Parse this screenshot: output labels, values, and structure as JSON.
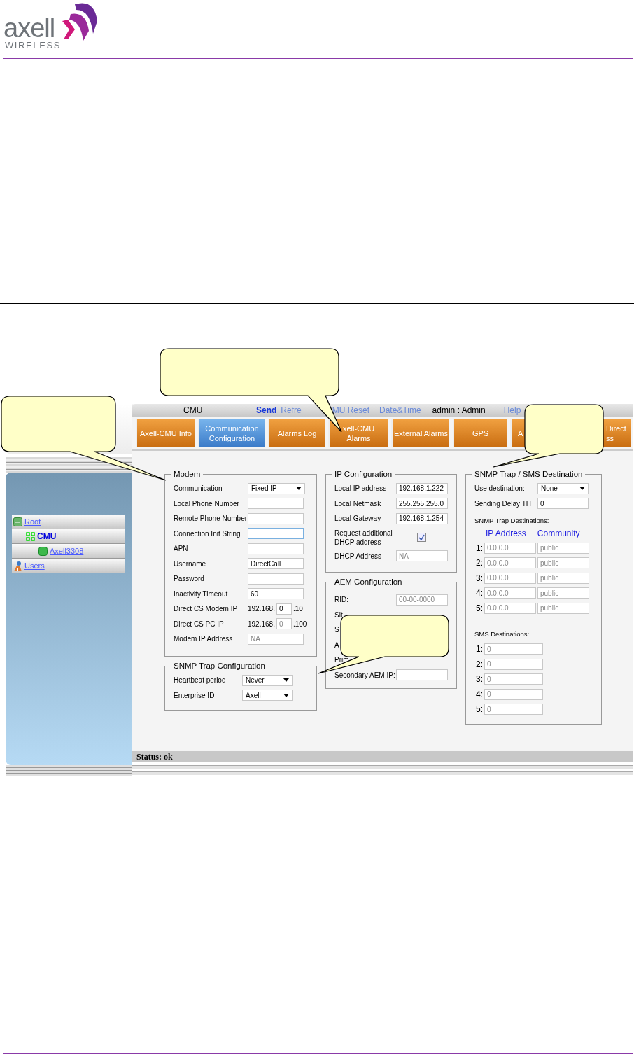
{
  "header": {
    "logo_word": "axell",
    "logo_sub": "WIRELESS"
  },
  "app": {
    "sidebar": {
      "tree": [
        {
          "label": "Root",
          "kind": "root",
          "selected": false,
          "children": [
            {
              "label": "CMU",
              "kind": "group",
              "selected": true,
              "children": [
                {
                  "label": "Axell3308",
                  "kind": "device",
                  "selected": false
                }
              ]
            }
          ]
        },
        {
          "label": "Users",
          "kind": "users",
          "selected": false
        }
      ]
    },
    "topbar": {
      "title": "CMU",
      "items": [
        {
          "label": "Send",
          "kind": "primary-link"
        },
        {
          "label": "Refre",
          "kind": "link"
        },
        {
          "label": "MU Reset",
          "kind": "link"
        },
        {
          "label": "Date&Time",
          "kind": "link"
        },
        {
          "label": "admin : Admin",
          "kind": "user"
        },
        {
          "label": "Help",
          "kind": "link"
        }
      ]
    },
    "tabs": [
      {
        "label": "Axell-CMU Info",
        "selected": false
      },
      {
        "label": "Communication\nConfiguration",
        "selected": true
      },
      {
        "label": "Alarms Log",
        "selected": false
      },
      {
        "label": "xell-CMU\nAlarms",
        "selected": false
      },
      {
        "label": "External Alarms",
        "selected": false
      },
      {
        "label": "GPS",
        "selected": false
      },
      {
        "label": "A",
        "selected": false
      },
      {
        "label": "Direct\nss",
        "selected": false
      }
    ],
    "modem": {
      "title": "Modem",
      "fields": [
        {
          "label": "Communication",
          "kind": "select",
          "value": "Fixed IP"
        },
        {
          "label": "Local Phone Number",
          "kind": "input"
        },
        {
          "label": "Remote Phone Number",
          "kind": "input"
        },
        {
          "label": "Connection Init String",
          "kind": "input",
          "focused": true
        },
        {
          "label": "APN",
          "kind": "input"
        },
        {
          "label": "Username",
          "kind": "input",
          "value": "DirectCall"
        },
        {
          "label": "Password",
          "kind": "input"
        },
        {
          "label": "Inactivity Timeout",
          "kind": "input",
          "value": "60"
        },
        {
          "label": "Direct CS Modem IP",
          "kind": "ip",
          "prefix": "192.168.",
          "value": "0",
          "suffix": ".10"
        },
        {
          "label": "Direct CS PC IP",
          "kind": "ip",
          "prefix": "192.168.",
          "value": "0",
          "suffix": ".100",
          "disabled": true
        },
        {
          "label": "Modem IP Address",
          "kind": "input",
          "value": "NA",
          "disabled": true
        }
      ]
    },
    "snmp_trap": {
      "title": "SNMP Trap Configuration",
      "fields": [
        {
          "label": "Heartbeat period",
          "kind": "select",
          "value": "Never"
        },
        {
          "label": "Enterprise ID",
          "kind": "select",
          "value": "Axell"
        }
      ]
    },
    "ip_config": {
      "title": "IP Configuration",
      "fields": [
        {
          "label": "Local IP address",
          "kind": "input",
          "value": "192.168.1.222"
        },
        {
          "label": "Local Netmask",
          "kind": "input",
          "value": "255.255.255.0"
        },
        {
          "label": "Local Gateway",
          "kind": "input",
          "value": "192.168.1.254"
        },
        {
          "label": "Request additional DHCP address",
          "kind": "checkbox",
          "checked": true
        },
        {
          "label": "DHCP Address",
          "kind": "input",
          "value": "NA",
          "disabled": true
        }
      ]
    },
    "aem_config": {
      "title": "AEM Configuration",
      "fields": [
        {
          "label": "RID:",
          "kind": "input",
          "value": "00-00-0000",
          "disabled": true
        },
        {
          "label": "Sit",
          "kind": "covered"
        },
        {
          "label": "S",
          "kind": "covered"
        },
        {
          "label": "A",
          "kind": "covered"
        },
        {
          "label": "Prim",
          "kind": "covered"
        },
        {
          "label": "Secondary AEM IP:",
          "kind": "input"
        }
      ]
    },
    "destination": {
      "title": "SNMP Trap / SMS Destination",
      "fields": [
        {
          "label": "Use destination:",
          "kind": "select",
          "value": "None"
        },
        {
          "label": "Sending Delay TH",
          "kind": "input",
          "value": "0"
        }
      ],
      "trap_title": "SNMP Trap Destinations:",
      "trap_headers": [
        "IP Address",
        "Community"
      ],
      "trap_rows": [
        {
          "index": "1:",
          "ip": "0.0.0.0",
          "community": "public",
          "disabled": true
        },
        {
          "index": "2:",
          "ip": "0.0.0.0",
          "community": "public",
          "disabled": true
        },
        {
          "index": "3:",
          "ip": "0.0.0.0",
          "community": "public",
          "disabled": true
        },
        {
          "index": "4:",
          "ip": "0.0.0.0",
          "community": "public",
          "disabled": true
        },
        {
          "index": "5:",
          "ip": "0.0.0.0",
          "community": "public",
          "disabled": true
        }
      ],
      "sms_title": "SMS Destinations:",
      "sms_rows": [
        {
          "index": "1:",
          "value": "0",
          "disabled": true
        },
        {
          "index": "2:",
          "value": "0",
          "disabled": true
        },
        {
          "index": "3:",
          "value": "0",
          "disabled": true
        },
        {
          "index": "4:",
          "value": "0",
          "disabled": true
        },
        {
          "index": "5:",
          "value": "0",
          "disabled": true
        }
      ]
    },
    "status": "Status: ok"
  }
}
